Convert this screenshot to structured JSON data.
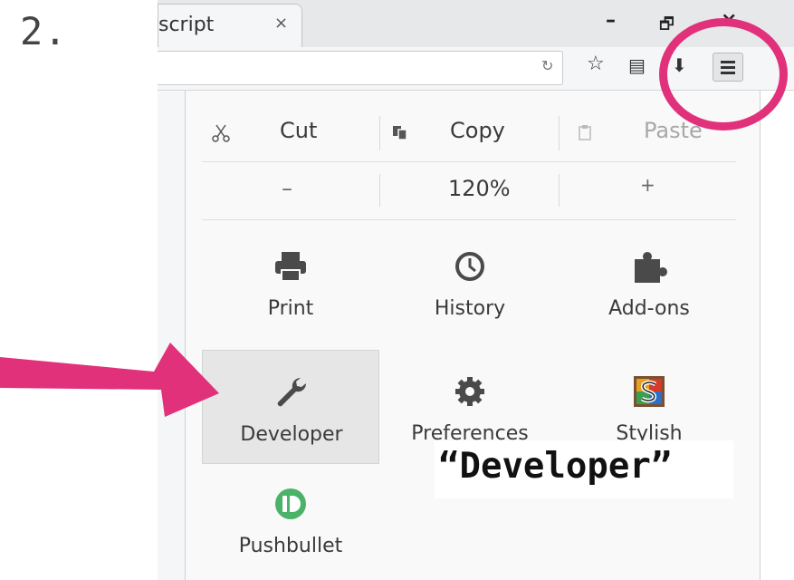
{
  "step": {
    "label": "2."
  },
  "tab": {
    "title": "script",
    "close": "×"
  },
  "window": {
    "minimize": "–",
    "restore": "🗗",
    "close": "×"
  },
  "navbar": {
    "reload": "↻",
    "bookmark_star": "☆",
    "reader": "▤",
    "download": "⬇"
  },
  "edit_row": {
    "cut": "Cut",
    "copy": "Copy",
    "paste": "Paste"
  },
  "zoom_row": {
    "minus": "–",
    "level": "120%",
    "plus": "+"
  },
  "grid": [
    {
      "label": "Print",
      "icon": "printer-icon"
    },
    {
      "label": "History",
      "icon": "clock-icon"
    },
    {
      "label": "Add-ons",
      "icon": "puzzle-icon"
    },
    {
      "label": "Developer",
      "icon": "wrench-icon"
    },
    {
      "label": "Preferences",
      "icon": "gear-icon"
    },
    {
      "label": "Stylish",
      "icon": "stylish-logo-icon"
    },
    {
      "label": "Pushbullet",
      "icon": "pushbullet-logo-icon"
    }
  ],
  "callout": {
    "text": "“Developer”"
  },
  "colors": {
    "highlight": "#e0317a",
    "pushbullet": "#4ab367",
    "icon": "#4a4a4a"
  }
}
